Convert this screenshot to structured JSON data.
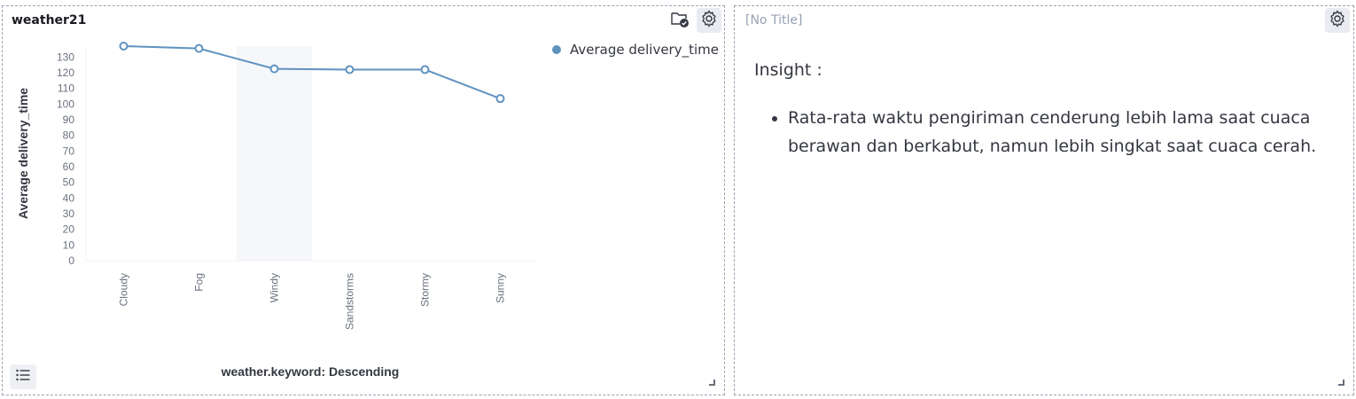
{
  "left_panel": {
    "title": "weather21",
    "legend": {
      "label": "Average delivery_time",
      "color": "#6092c0"
    }
  },
  "right_panel": {
    "title": "[No Title]",
    "heading": "Insight :",
    "bullets": [
      "Rata-rata waktu pengiriman cenderung lebih lama saat cuaca berawan dan berkabut, namun lebih singkat saat cuaca cerah."
    ]
  },
  "chart_data": {
    "type": "line",
    "categories": [
      "Cloudy",
      "Fog",
      "Windy",
      "Sandstorms",
      "Stormy",
      "Sunny"
    ],
    "series": [
      {
        "name": "Average delivery_time",
        "values": [
          137,
          135.5,
          122.5,
          122,
          122,
          103.5
        ],
        "color": "#6092c0"
      }
    ],
    "xlabel": "weather.keyword: Descending",
    "ylabel": "Average delivery_time",
    "ylim": [
      0,
      137
    ],
    "yticks": [
      0,
      10,
      20,
      30,
      40,
      50,
      60,
      70,
      80,
      90,
      100,
      110,
      120,
      130
    ],
    "highlighted_category": "Windy",
    "legend_position": "top-right",
    "grid": false
  }
}
